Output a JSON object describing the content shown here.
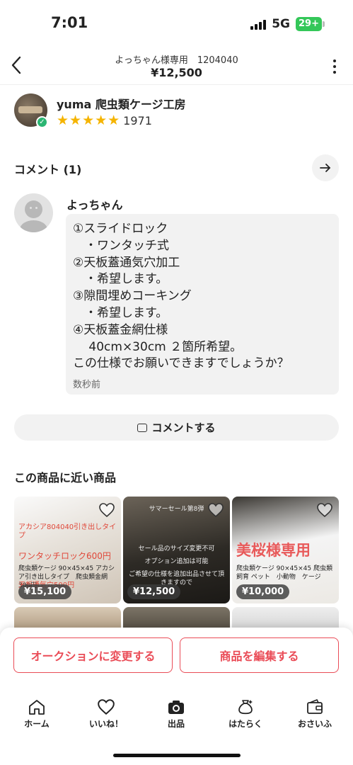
{
  "status_bar": {
    "time": "7:01",
    "network": "5G",
    "battery": "29+"
  },
  "header": {
    "title": "よっちゃん様専用　1204040",
    "price": "¥12,500"
  },
  "seller": {
    "name": "yuma 爬虫類ケージ工房",
    "stars": "★★★★★",
    "rating_count": "1971"
  },
  "comments": {
    "heading": "コメント (1)",
    "items": [
      {
        "author": "よっちゃん",
        "lines": [
          "①スライドロック",
          "　・ワンタッチ式",
          "②天板蓋通気穴加工",
          "　・希望します。",
          "③隙間埋めコーキング",
          "　・希望します。",
          "④天板蓋金網仕様",
          "　 40cm×30cm ２箇所希望。",
          "この仕様でお願いできますでしょうか？"
        ],
        "time": "数秒前"
      }
    ],
    "button_label": "コメントする"
  },
  "similar": {
    "heading": "この商品に近い商品",
    "items": [
      {
        "price": "¥15,100",
        "overlay_top": "アカシア804040引き出しタイプ",
        "overlay_mid": "ワンタッチロック600円",
        "overlay_sub": "天板通気穴500円",
        "title": "爬虫類ケージ 90×45×45 アカシア引き出しタイプ　爬虫類金網300円"
      },
      {
        "price": "¥12,500",
        "overlay_top": "サマーセール第8弾",
        "overlay_mid": "セール品のサイズ変更不可",
        "overlay_sub": "オプション追加は可能",
        "title": "ご希望の仕様を追加出品させて頂きますので"
      },
      {
        "price": "¥10,000",
        "overlay_top": "美桜様専用",
        "title": "爬虫類ケージ 90×45×45 爬虫類　飼育 ペット　小動物　ケージ"
      }
    ]
  },
  "actions": {
    "auction_label": "オークションに変更する",
    "edit_label": "商品を編集する"
  },
  "tabbar": {
    "items": [
      {
        "label": "ホーム",
        "icon": "home-icon"
      },
      {
        "label": "いいね！",
        "icon": "heart-icon"
      },
      {
        "label": "出品",
        "icon": "camera-icon"
      },
      {
        "label": "はたらく",
        "icon": "money-bag-icon"
      },
      {
        "label": "おさいふ",
        "icon": "wallet-icon"
      }
    ]
  },
  "colors": {
    "accent": "#ea4c57",
    "star": "#f5b400",
    "verified": "#2bb673"
  }
}
